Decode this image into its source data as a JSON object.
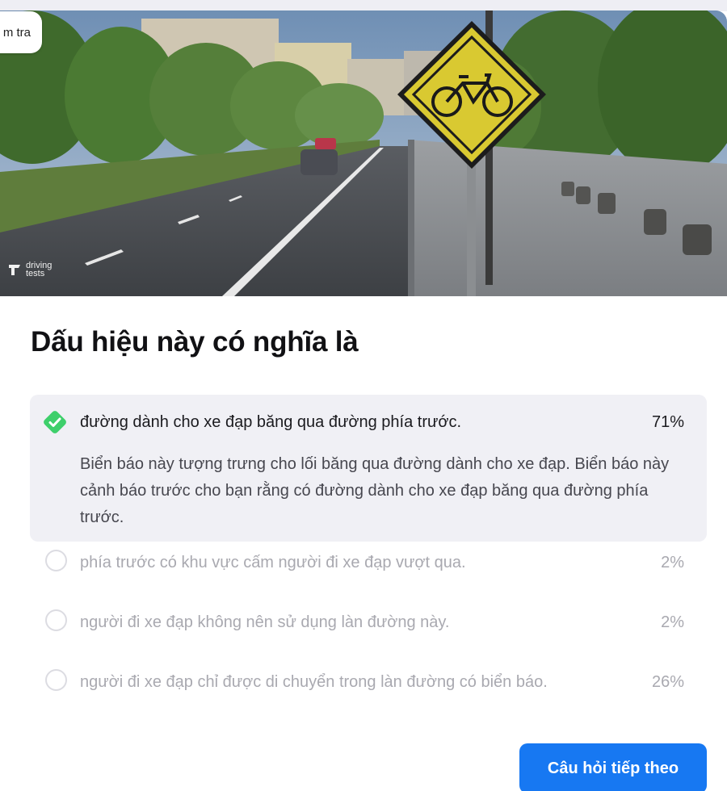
{
  "header": {
    "tab_label": "m tra"
  },
  "hero": {
    "watermark_line1": "driving",
    "watermark_line2": "tests",
    "sign_icon": "bicycle-icon"
  },
  "question": {
    "title": "Dấu hiệu này có nghĩa là",
    "answers": [
      {
        "text": "đường dành cho xe đạp băng qua đường phía trước.",
        "percent": "71%",
        "correct": true,
        "explanation": "Biển báo này tượng trưng cho lối băng qua đường dành cho xe đạp. Biển báo này cảnh báo trước cho bạn rằng có đường dành cho xe đạp băng qua đường phía trước."
      },
      {
        "text": "phía trước có khu vực cấm người đi xe đạp vượt qua.",
        "percent": "2%",
        "correct": false
      },
      {
        "text": "người đi xe đạp không nên sử dụng làn đường này.",
        "percent": "2%",
        "correct": false
      },
      {
        "text": "người đi xe đạp chỉ được di chuyển trong làn đường có biển báo.",
        "percent": "26%",
        "correct": false
      }
    ]
  },
  "actions": {
    "next_label": "Câu hỏi tiếp theo"
  },
  "colors": {
    "accent": "#1778f2",
    "correct": "#3ecf6b",
    "selected_bg": "#f0f0f5",
    "muted_text": "#a9a9b0"
  }
}
